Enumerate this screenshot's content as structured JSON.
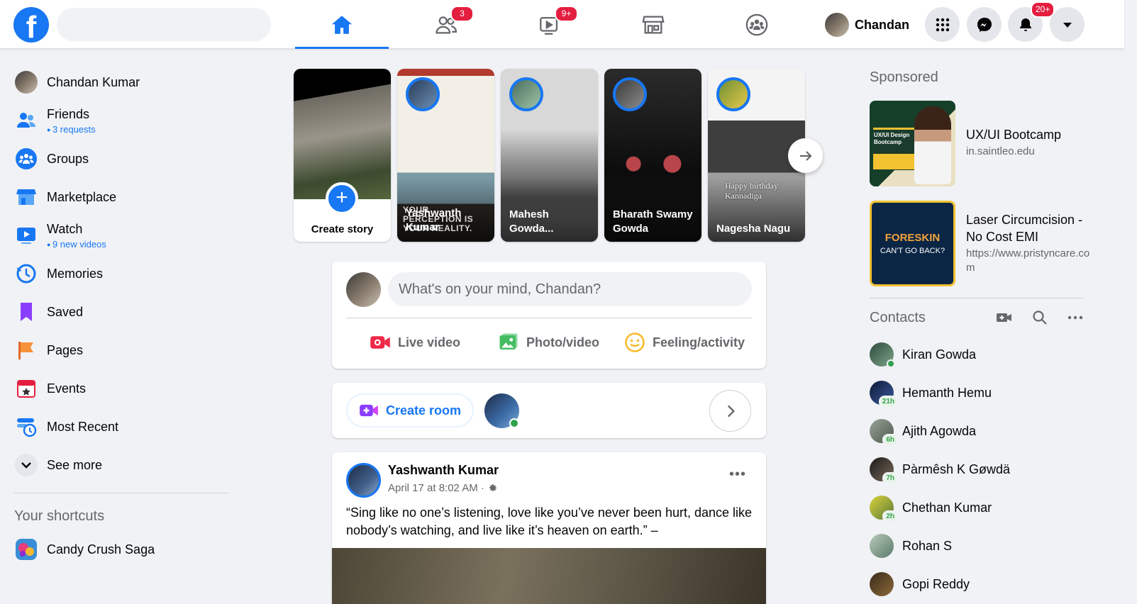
{
  "header": {
    "logo_letter": "f",
    "search_placeholder": "",
    "nav": [
      {
        "name": "home",
        "badge": ""
      },
      {
        "name": "friends",
        "badge": "3"
      },
      {
        "name": "watch",
        "badge": "9+"
      },
      {
        "name": "marketplace",
        "badge": ""
      },
      {
        "name": "groups",
        "badge": ""
      }
    ],
    "profile_name": "Chandan",
    "notifications_badge": "20+"
  },
  "sidebar": {
    "items": [
      {
        "label": "Chandan Kumar",
        "sub": ""
      },
      {
        "label": "Friends",
        "sub": "3 requests"
      },
      {
        "label": "Groups",
        "sub": ""
      },
      {
        "label": "Marketplace",
        "sub": ""
      },
      {
        "label": "Watch",
        "sub": "9 new videos"
      },
      {
        "label": "Memories",
        "sub": ""
      },
      {
        "label": "Saved",
        "sub": ""
      },
      {
        "label": "Pages",
        "sub": ""
      },
      {
        "label": "Events",
        "sub": ""
      },
      {
        "label": "Most Recent",
        "sub": ""
      },
      {
        "label": "See more",
        "sub": ""
      }
    ],
    "shortcuts_heading": "Your shortcuts",
    "shortcuts": [
      {
        "label": "Candy Crush Saga"
      }
    ]
  },
  "stories": {
    "create_label": "Create story",
    "items": [
      {
        "name": "Yashwanth Kumar",
        "overlay_text": "YOUR PERCEPTION IS YOUR REALITY."
      },
      {
        "name": "Mahesh Gowda..."
      },
      {
        "name": "Bharath Swamy Gowda"
      },
      {
        "name": "Nagesha Nagu",
        "overlay_text": "Happy birthday Kannadiga"
      }
    ]
  },
  "composer": {
    "placeholder": "What's on your mind, Chandan?",
    "actions": {
      "live": "Live video",
      "photo": "Photo/video",
      "feeling": "Feeling/activity"
    }
  },
  "rooms": {
    "create_label": "Create room"
  },
  "post": {
    "author": "Yashwanth Kumar",
    "timestamp": "April 17 at 8:02 AM ·",
    "text": "“Sing like no one’s listening, love like you’ve never been hurt, dance like nobody’s watching, and live like it’s heaven on earth.” –"
  },
  "sponsored": {
    "heading": "Sponsored",
    "ads": [
      {
        "title": "UX/UI Bootcamp",
        "url": "in.saintleo.edu",
        "thumb_text": "UX/UI Design Bootcamp"
      },
      {
        "title": "Laser Circumcision - No Cost EMI",
        "url": "https://www.pristyncare.com",
        "thumb_line1": "FORESKIN",
        "thumb_line2": "CAN'T GO BACK?"
      }
    ]
  },
  "contacts": {
    "heading": "Contacts",
    "items": [
      {
        "name": "Kiran Gowda",
        "status": "online",
        "since": ""
      },
      {
        "name": "Hemanth Hemu",
        "status": "away",
        "since": "21h"
      },
      {
        "name": "Ajith Agowda",
        "status": "away",
        "since": "6h"
      },
      {
        "name": "Pàrmêsh K Gøwdä",
        "status": "away",
        "since": "7h"
      },
      {
        "name": "Chethan Kumar",
        "status": "away",
        "since": "2h"
      },
      {
        "name": "Rohan S",
        "status": "none",
        "since": ""
      },
      {
        "name": "Gopi Reddy",
        "status": "none",
        "since": ""
      }
    ]
  },
  "colors": {
    "brand": "#1877f2",
    "badge": "#e41e3f",
    "online": "#31a24c",
    "background": "#f0f2f5"
  }
}
